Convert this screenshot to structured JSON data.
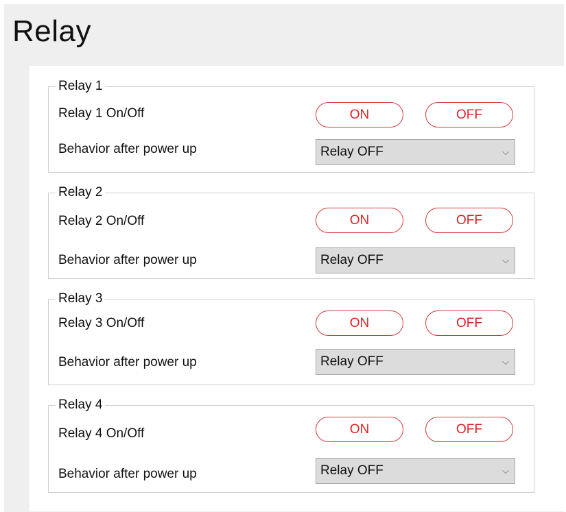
{
  "page": {
    "title": "Relay"
  },
  "relays": [
    {
      "legend": "Relay 1",
      "toggle_label": "Relay 1 On/Off",
      "on_label": "ON",
      "off_label": "OFF",
      "behavior_label": "Behavior after power up",
      "behavior_value": "Relay OFF"
    },
    {
      "legend": "Relay 2",
      "toggle_label": "Relay 2 On/Off",
      "on_label": "ON",
      "off_label": "OFF",
      "behavior_label": "Behavior after power up",
      "behavior_value": "Relay OFF"
    },
    {
      "legend": "Relay 3",
      "toggle_label": "Relay 3 On/Off",
      "on_label": "ON",
      "off_label": "OFF",
      "behavior_label": "Behavior after power up",
      "behavior_value": "Relay OFF"
    },
    {
      "legend": "Relay 4",
      "toggle_label": "Relay 4 On/Off",
      "on_label": "ON",
      "off_label": "OFF",
      "behavior_label": "Behavior after power up",
      "behavior_value": "Relay OFF"
    }
  ],
  "colors": {
    "button_accent": "#d83a3a",
    "select_bg": "#dcdcdc",
    "page_bg": "#efefef"
  },
  "icons": {
    "select_arrow": "chevron-down-icon"
  }
}
